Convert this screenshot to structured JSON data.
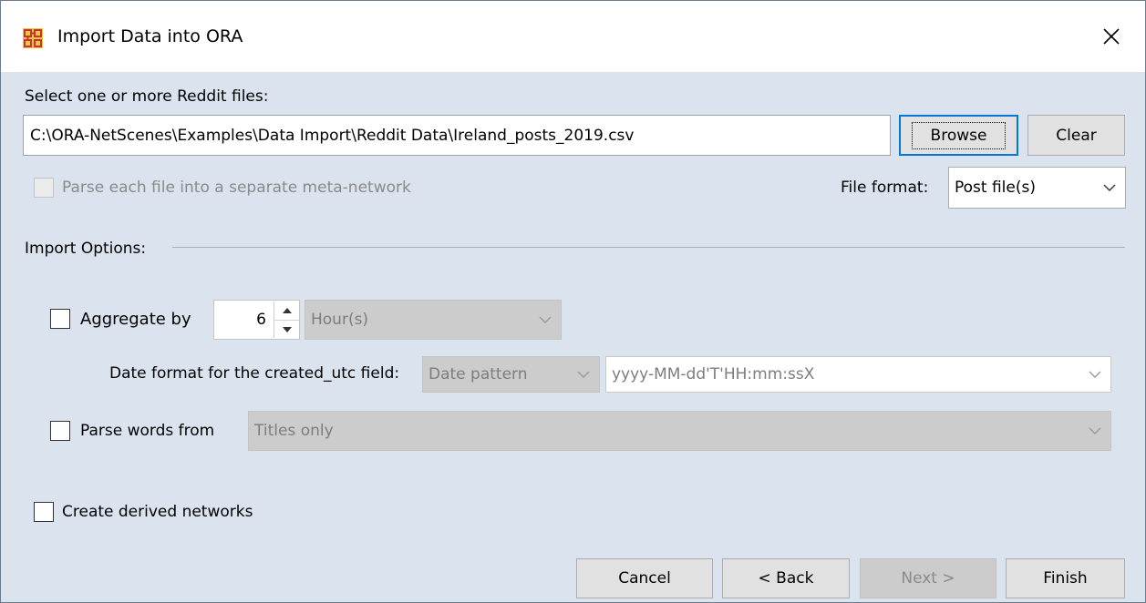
{
  "window": {
    "title": "Import Data into ORA",
    "close_label": "×"
  },
  "files": {
    "label": "Select one or more Reddit files:",
    "path_value": "C:\\ORA-NetScenes\\Examples\\Data Import\\Reddit Data\\Ireland_posts_2019.csv",
    "browse_label": "Browse",
    "clear_label": "Clear",
    "separate_label": "Parse each file into a separate meta-network",
    "separate_checked": false,
    "format_label": "File format:",
    "format_value": "Post file(s)"
  },
  "import_options": {
    "heading": "Import Options:",
    "aggregate": {
      "label": "Aggregate by",
      "checked": false,
      "amount": "6",
      "unit": "Hour(s)"
    },
    "date_format": {
      "label": "Date format for the created_utc field:",
      "type": "Date pattern",
      "pattern": "yyyy-MM-dd'T'HH:mm:ssX"
    },
    "parse_words": {
      "label": "Parse words from",
      "checked": false,
      "source": "Titles only"
    },
    "derived": {
      "label": "Create derived networks",
      "checked": false
    }
  },
  "footer": {
    "cancel": "Cancel",
    "back": "< Back",
    "next": "Next >",
    "finish": "Finish"
  },
  "colors": {
    "dialog_bg": "#dae3ee",
    "focus_border": "#0078d7"
  }
}
